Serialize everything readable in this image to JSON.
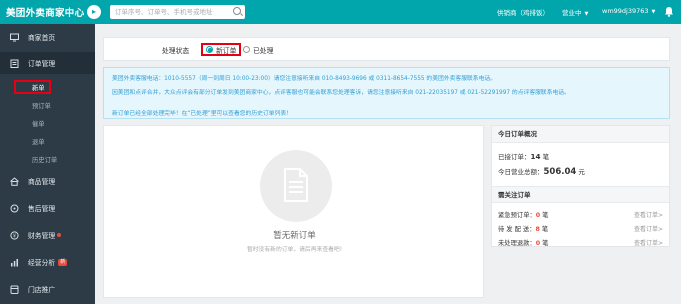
{
  "header": {
    "brand": "美团外卖商家中心",
    "toggle_icon": "arrow-icon",
    "search_placeholder": "订单序号、订单号、手机号或地址",
    "store_name": "供销商（鸡排饭）",
    "status": "营业中",
    "account": "wm99dj39763",
    "bell_icon": "bell-icon",
    "accent_color": "#00a6ac"
  },
  "sidebar": {
    "home": "商家首页",
    "orders": "订单管理",
    "sub_items": [
      "新单",
      "预订单",
      "催单",
      "退单",
      "历史订单"
    ],
    "goods": "商品管理",
    "after_sales": "售后管理",
    "finance": "财务管理",
    "analysis": "经营分析",
    "analysis_badge": "新",
    "store_promo": "门店推广"
  },
  "filter": {
    "label": "处理状态",
    "options": [
      "新订单",
      "已处理"
    ],
    "selected": "新订单"
  },
  "notice": {
    "line1": "美团外卖客服电话：1010-5557（周一到周日 10:00-23:00）请您注意接听来自 010-8493-9696 或 0311-8654-7555 的美团外卖客服联系电话。",
    "line2": "因美团和点评合并，大众点评会有部分订单发到美团商家中心，点评客服也可能会联系您处理客诉，请您注意接听来自 021-22035197 或 021-52291997 的点评客服联系电话。",
    "line3": "新订单已经全部处理完毕！在“已处理”里可以查看您的历史订单列表！"
  },
  "empty": {
    "title": "暂无新订单",
    "subtitle": "暂时没有新的订单，请后再来查看吧!",
    "icon": "document-icon"
  },
  "today": {
    "title": "今日订单概况",
    "accepted_label": "已接订单：",
    "accepted_value": "14",
    "accepted_unit": " 笔",
    "revenue_label": "今日营业总额：",
    "revenue_value": "506.04",
    "revenue_unit": " 元"
  },
  "watch": {
    "title": "需关注订单",
    "rows": [
      {
        "label": "紧急预订单：",
        "value": "0",
        "unit": " 笔",
        "link": "查看订单>"
      },
      {
        "label": "待 发 配 送：",
        "value": "8",
        "unit": " 笔",
        "link": "查看订单>"
      },
      {
        "label": "未处理退款：",
        "value": "0",
        "unit": " 笔",
        "link": "查看订单>"
      }
    ]
  }
}
